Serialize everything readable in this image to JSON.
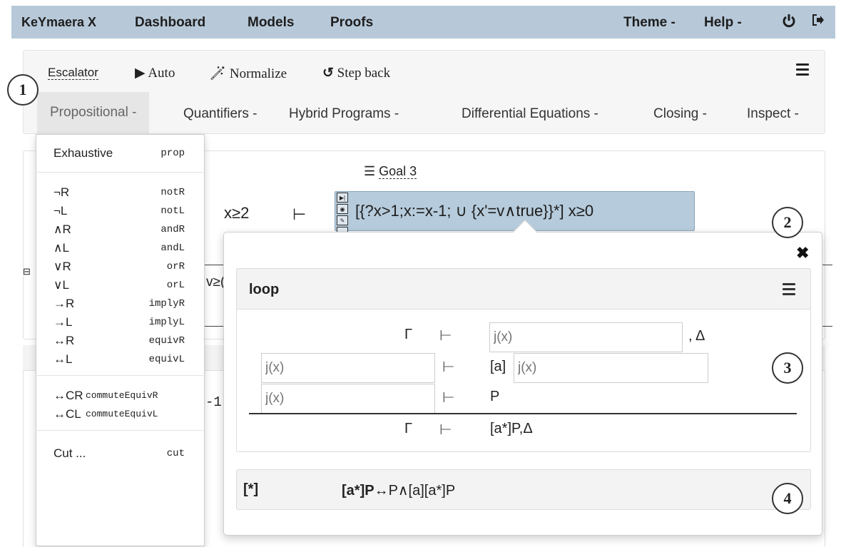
{
  "navbar": {
    "brand": "KeYmaera X",
    "links": [
      "Dashboard",
      "Models",
      "Proofs"
    ],
    "theme": "Theme -",
    "help": "Help -",
    "power_icon": "power-icon",
    "logout_icon": "logout-icon"
  },
  "tacticbar": {
    "escalator": "Escalator",
    "auto": "Auto",
    "normalize": "Normalize",
    "step_back": "Step back",
    "menus": [
      "Propositional -",
      "Quantifiers -",
      "Hybrid Programs -",
      "Differential Equations -",
      "Closing -",
      "Inspect -"
    ]
  },
  "callouts": [
    "1",
    "2",
    "3",
    "4"
  ],
  "dropdown": {
    "groups": [
      [
        {
          "label": "Exhaustive",
          "code": "prop"
        }
      ],
      [
        {
          "label": "¬R",
          "code": "notR"
        },
        {
          "label": "¬L",
          "code": "notL"
        },
        {
          "label": "∧R",
          "code": "andR"
        },
        {
          "label": "∧L",
          "code": "andL"
        },
        {
          "label": "∨R",
          "code": "orR"
        },
        {
          "label": "∨L",
          "code": "orL"
        },
        {
          "label": "→R",
          "code": "implyR"
        },
        {
          "label": "→L",
          "code": "implyL"
        },
        {
          "label": "↔R",
          "code": "equivR"
        },
        {
          "label": "↔L",
          "code": "equivL"
        }
      ],
      [
        {
          "label": "↔CR",
          "code": "commuteEquivR"
        },
        {
          "label": "↔CL",
          "code": "commuteEquivL"
        }
      ],
      [
        {
          "label": "Cut ...",
          "code": "cut"
        }
      ]
    ]
  },
  "goal": {
    "label": "Goal 3",
    "antecedent": "x≥2",
    "turnstile": "⊢",
    "formula": "[{?x>1;x:=x-1;  ∪  {x'=v∧true}}*] x≥0",
    "bg_v": "v≥(",
    "bg_minus": "-1",
    "collapse_icon": "⊟"
  },
  "popover": {
    "close": "✖",
    "title": "loop",
    "premise1": {
      "ante": "Γ",
      "turnstile": "⊢",
      "input_placeholder": "j(x)",
      "rest": ", Δ"
    },
    "premise2": {
      "input_placeholder": "j(x)",
      "turnstile": "⊢",
      "prefix": "[a]",
      "input2_placeholder": "j(x)"
    },
    "premise3": {
      "input_placeholder": "j(x)",
      "turnstile": "⊢",
      "post": "P"
    },
    "conclusion": {
      "ante": "Γ",
      "turnstile": "⊢",
      "succ": "[a*]P,Δ"
    },
    "axiom": {
      "name": "[*]",
      "lhs": "[a*]P",
      "rest": "↔P∧[a][a*]P"
    }
  }
}
